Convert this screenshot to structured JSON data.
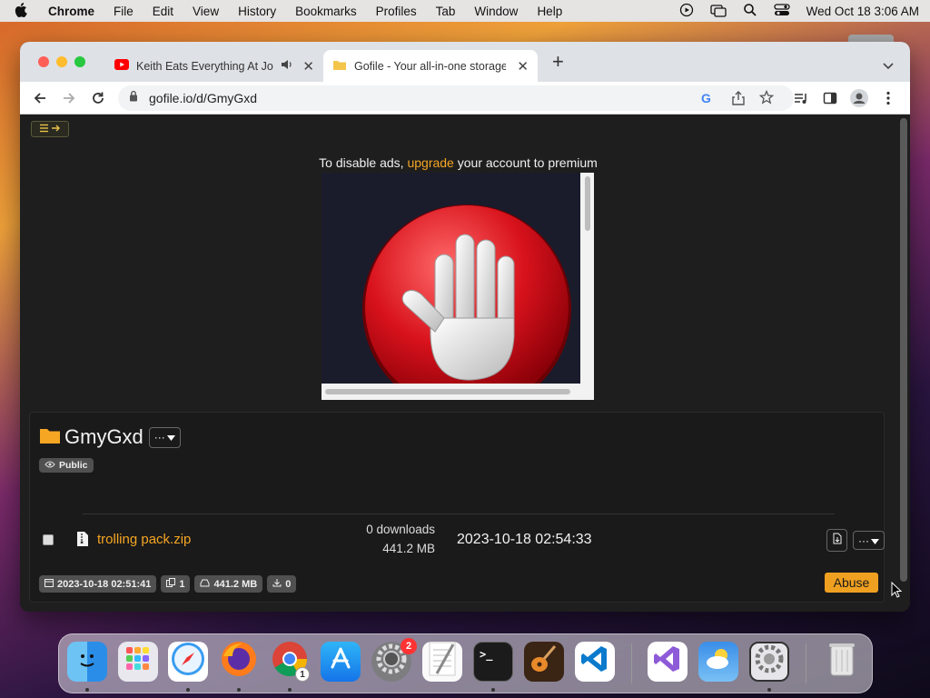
{
  "menubar": {
    "app": "Chrome",
    "items": [
      "File",
      "Edit",
      "View",
      "History",
      "Bookmarks",
      "Profiles",
      "Tab",
      "Window",
      "Help"
    ],
    "clock": "Wed Oct 18  3:06 AM"
  },
  "tabs": [
    {
      "title": "Keith Eats Everything At Jo",
      "icon": "youtube-icon",
      "audio": true
    },
    {
      "title": "Gofile - Your all-in-one storage",
      "icon": "gofile-icon"
    }
  ],
  "address": {
    "url": "gofile.io/d/GmyGxd"
  },
  "ad": {
    "prefix": "To disable ads, ",
    "link": "upgrade",
    "suffix": " your account to premium"
  },
  "folder": {
    "name": "GmyGxd",
    "visibility": "Public",
    "file": {
      "name": "trolling pack.zip",
      "downloads": "0 downloads",
      "size": "441.2 MB",
      "date": "2023-10-18 02:54:33"
    },
    "footer": {
      "created": "2023-10-18 02:51:41",
      "files": "1",
      "total_size": "441.2 MB",
      "downloads": "0"
    },
    "abuse_label": "Abuse"
  },
  "dock": {
    "apps": [
      "Finder",
      "Launchpad",
      "Safari",
      "Firefox",
      "Chrome",
      "App Store",
      "System Preferences",
      "TextEdit",
      "Terminal",
      "GarageBand",
      "Visual Studio Code",
      "Visual Studio",
      "Weather",
      "Settings",
      "Trash"
    ],
    "badges": {
      "system_preferences": "2",
      "chrome": "1"
    }
  },
  "colors": {
    "accent": "#f5a623",
    "abuse_bg": "#f0a020",
    "page_bg": "#1e1e1e",
    "stop_red": "#d8121c"
  }
}
